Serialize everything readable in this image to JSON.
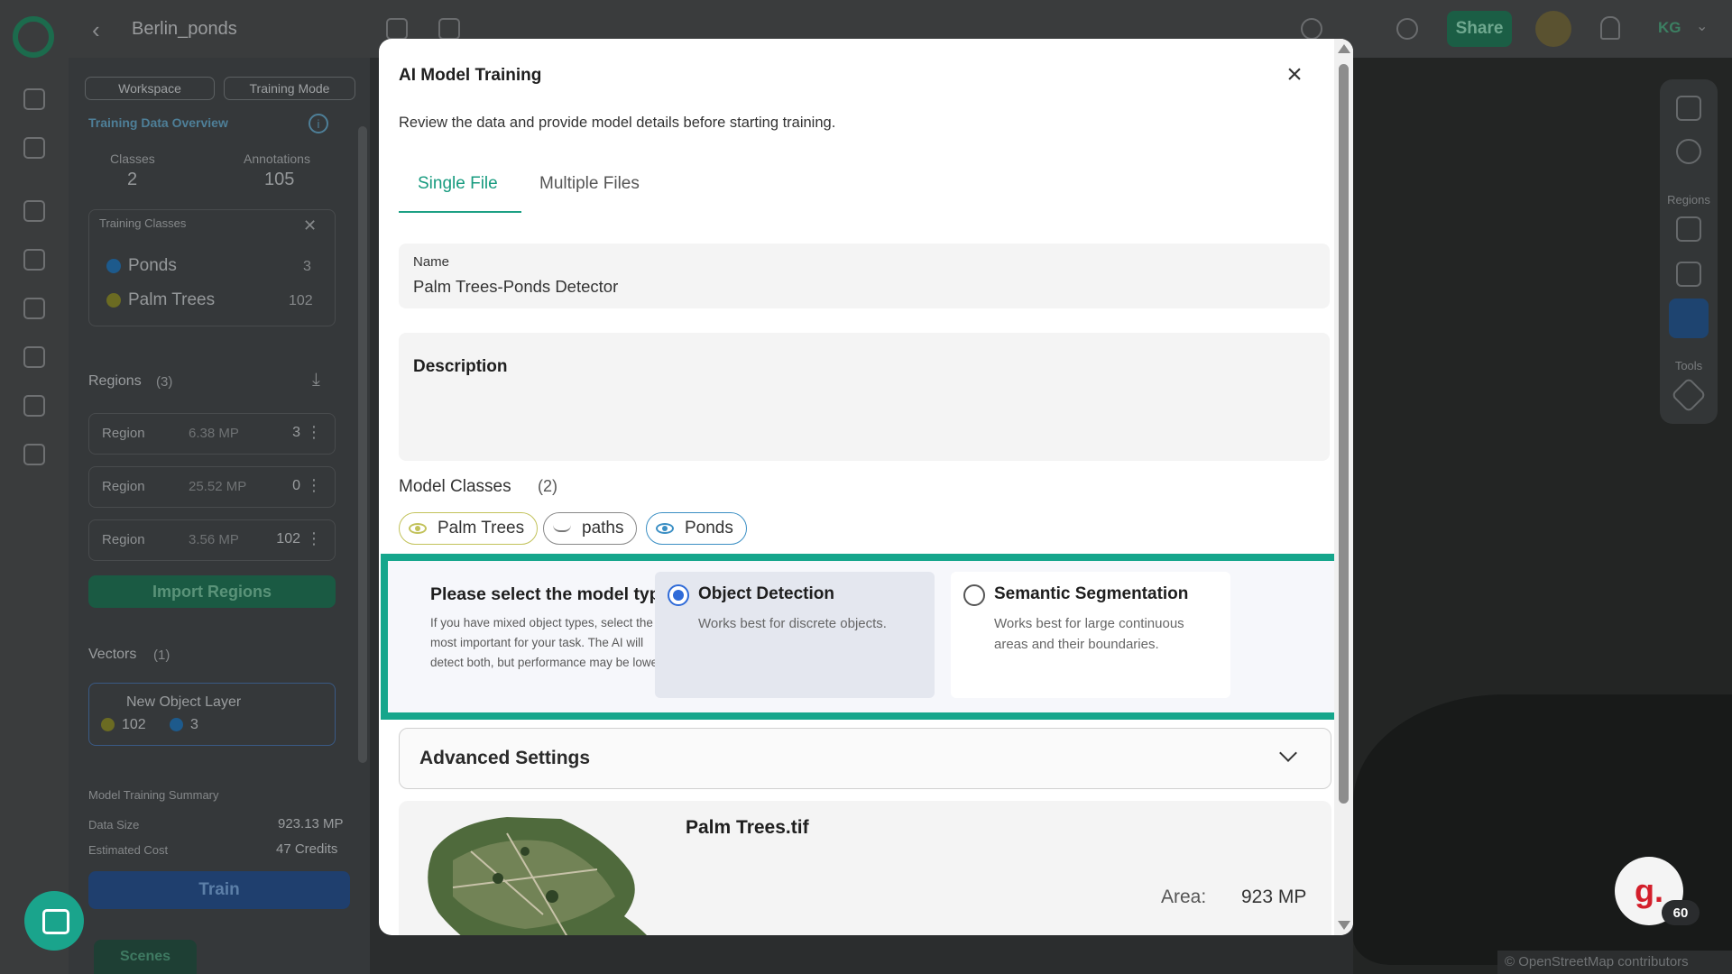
{
  "app": {
    "project_title": "Berlin_ponds",
    "share_label": "Share",
    "user_initials": "KG"
  },
  "side_panel": {
    "workspace_label": "Workspace",
    "training_mode_label": "Training Mode",
    "overview_title": "Training Data Overview",
    "classes_label": "Classes",
    "classes_value": "2",
    "annotations_label": "Annotations",
    "annotations_value": "105",
    "training_classes_title": "Training Classes",
    "training_classes": [
      {
        "name": "Ponds",
        "count": "3",
        "color": "#1d5a8c"
      },
      {
        "name": "Palm Trees",
        "count": "102",
        "color": "#6b6b22"
      }
    ],
    "regions_title": "Regions",
    "regions_count": "(3)",
    "regions": [
      {
        "label": "Region",
        "size": "6.38 MP",
        "count": "3"
      },
      {
        "label": "Region",
        "size": "25.52 MP",
        "count": "0"
      },
      {
        "label": "Region",
        "size": "3.56 MP",
        "count": "102"
      }
    ],
    "import_regions_label": "Import Regions",
    "vectors_title": "Vectors",
    "vectors_count": "(1)",
    "vector_layer_name": "New Object Layer",
    "vector_counts": [
      {
        "count": "102",
        "color": "#6b6b22"
      },
      {
        "count": "3",
        "color": "#1d5a8c"
      }
    ],
    "summary_title": "Model Training Summary",
    "data_size_label": "Data Size",
    "data_size_value": "923.13 MP",
    "estimated_cost_label": "Estimated Cost",
    "estimated_cost_value": "47 Credits",
    "train_label": "Train",
    "scenes_label": "Scenes"
  },
  "tool_rail": {
    "regions_label": "Regions",
    "tools_label": "Tools"
  },
  "map": {
    "credit": "© OpenStreetMap contributors"
  },
  "badge": {
    "letter": "g.",
    "count": "60"
  },
  "modal": {
    "title": "AI Model Training",
    "subtitle": "Review the data and provide model details before starting training.",
    "tabs": [
      {
        "label": "Single File",
        "active": true
      },
      {
        "label": "Multiple Files",
        "active": false
      }
    ],
    "name_label": "Name",
    "name_value": "Palm Trees-Ponds Detector",
    "description_label": "Description",
    "model_classes_label": "Model Classes",
    "model_classes_count": "(2)",
    "chips": [
      {
        "label": "Palm Trees",
        "visible": true,
        "color": "#c2c25a"
      },
      {
        "label": "paths",
        "visible": false,
        "color": "#888888"
      },
      {
        "label": "Ponds",
        "visible": true,
        "color": "#3b8fc4"
      }
    ],
    "model_type": {
      "heading": "Please select the model type:",
      "help": "If you have mixed object types, select the one most important for your task. The AI will detect both, but performance may be lower.",
      "options": [
        {
          "title": "Object Detection",
          "desc": "Works best for discrete objects.",
          "selected": true
        },
        {
          "title": "Semantic Segmentation",
          "desc": "Works best for large continuous areas and their boundaries.",
          "selected": false
        }
      ],
      "highlight_color": "#16a68c"
    },
    "advanced_label": "Advanced Settings",
    "file": {
      "name": "Palm Trees.tif",
      "area_label": "Area:",
      "area_value": "923 MP"
    }
  }
}
